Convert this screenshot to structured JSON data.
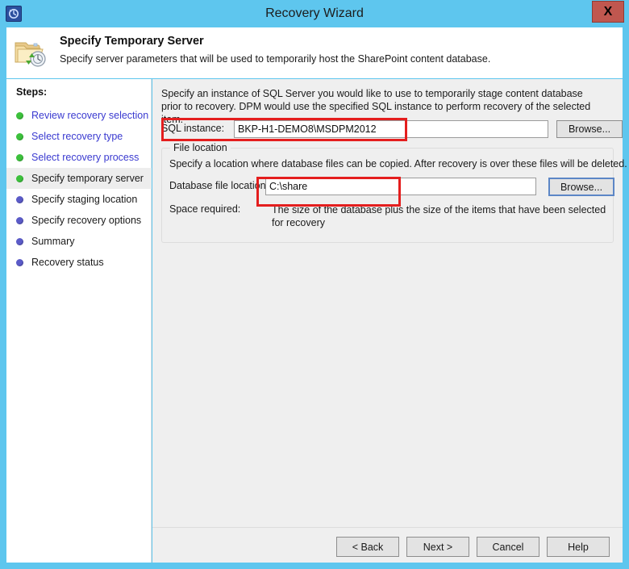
{
  "window": {
    "title": "Recovery Wizard",
    "app_icon": "recovery-clock-icon",
    "close_label": "X",
    "chrome_color": "#5ec6ee"
  },
  "header": {
    "icon": "folder-recovery-icon",
    "title": "Specify Temporary Server",
    "subtitle": "Specify server parameters that will be used to temporarily host the SharePoint content database."
  },
  "sidebar": {
    "heading": "Steps:",
    "items": [
      {
        "label": "Review recovery selection",
        "state": "done",
        "bullet": "green-bullet-icon"
      },
      {
        "label": "Select recovery type",
        "state": "done",
        "bullet": "green-bullet-icon"
      },
      {
        "label": "Select recovery process",
        "state": "done",
        "bullet": "green-bullet-icon"
      },
      {
        "label": "Specify temporary server",
        "state": "current",
        "bullet": "green-bullet-icon"
      },
      {
        "label": "Specify staging location",
        "state": "pending",
        "bullet": "purple-bullet-icon"
      },
      {
        "label": "Specify recovery options",
        "state": "pending",
        "bullet": "purple-bullet-icon"
      },
      {
        "label": "Summary",
        "state": "pending",
        "bullet": "purple-bullet-icon"
      },
      {
        "label": "Recovery status",
        "state": "pending",
        "bullet": "purple-bullet-icon"
      }
    ]
  },
  "main": {
    "intro": "Specify an instance of SQL Server you would like to use to temporarily stage content database prior to recovery. DPM would use the specified SQL instance to perform recovery of the selected item.",
    "sql_instance": {
      "label": "SQL instance:",
      "value": "BKP-H1-DEMO8\\MSDPM2012",
      "placeholder": "",
      "browse_label": "Browse..."
    },
    "file_location": {
      "group_title": "File location",
      "description": "Specify a location where database files can be copied. After recovery is over these files will be deleted.",
      "db_location_label": "Database file location:",
      "db_location_value": "C:\\share",
      "db_location_placeholder": "",
      "browse_label": "Browse...",
      "space_label": "Space required:",
      "space_value": "The size of the database plus the size of the items that have been selected for recovery"
    }
  },
  "footer": {
    "back_label": "< Back",
    "next_label": "Next >",
    "cancel_label": "Cancel",
    "help_label": "Help"
  },
  "annotations": {
    "color": "#e41e1e",
    "boxes": [
      "sql-instance-highlight",
      "database-file-location-highlight"
    ]
  }
}
